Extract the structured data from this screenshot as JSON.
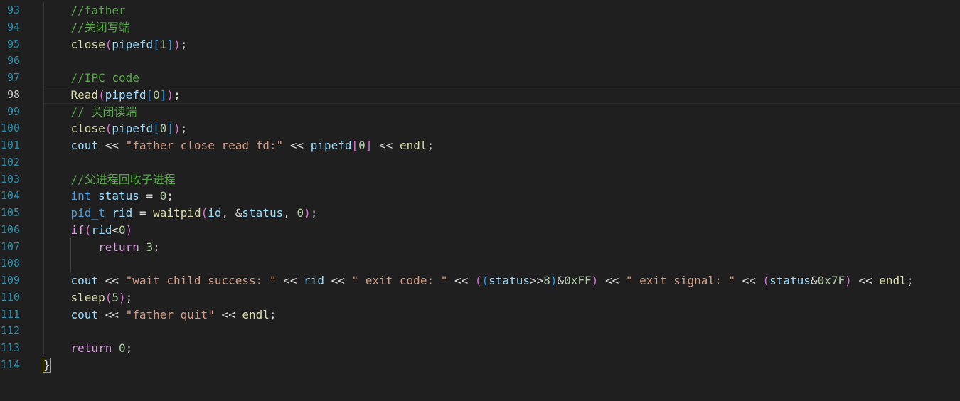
{
  "editor": {
    "lines": [
      {
        "no": "93",
        "tokens": [
          {
            "t": "    ",
            "c": "plain"
          },
          {
            "t": "//father",
            "c": "comment"
          }
        ]
      },
      {
        "no": "94",
        "tokens": [
          {
            "t": "    ",
            "c": "plain"
          },
          {
            "t": "//关闭写端",
            "c": "comment"
          }
        ]
      },
      {
        "no": "95",
        "tokens": [
          {
            "t": "    ",
            "c": "plain"
          },
          {
            "t": "close",
            "c": "func"
          },
          {
            "t": "(",
            "c": "bracket2"
          },
          {
            "t": "pipefd",
            "c": "var"
          },
          {
            "t": "[",
            "c": "bracket3"
          },
          {
            "t": "1",
            "c": "number"
          },
          {
            "t": "]",
            "c": "bracket3"
          },
          {
            "t": ")",
            "c": "bracket2"
          },
          {
            "t": ";",
            "c": "plain"
          }
        ]
      },
      {
        "no": "96",
        "tokens": []
      },
      {
        "no": "97",
        "tokens": [
          {
            "t": "    ",
            "c": "plain"
          },
          {
            "t": "//IPC code",
            "c": "comment"
          }
        ]
      },
      {
        "no": "98",
        "current": true,
        "tokens": [
          {
            "t": "    ",
            "c": "plain"
          },
          {
            "t": "Read",
            "c": "func"
          },
          {
            "t": "(",
            "c": "bracket2"
          },
          {
            "t": "pipefd",
            "c": "var"
          },
          {
            "t": "[",
            "c": "bracket3"
          },
          {
            "t": "0",
            "c": "number"
          },
          {
            "t": "]",
            "c": "bracket3"
          },
          {
            "t": ")",
            "c": "bracket2"
          },
          {
            "t": ";",
            "c": "plain"
          }
        ]
      },
      {
        "no": "99",
        "tokens": [
          {
            "t": "    ",
            "c": "plain"
          },
          {
            "t": "// 关闭读端",
            "c": "comment"
          }
        ]
      },
      {
        "no": "100",
        "tokens": [
          {
            "t": "    ",
            "c": "plain"
          },
          {
            "t": "close",
            "c": "func"
          },
          {
            "t": "(",
            "c": "bracket2"
          },
          {
            "t": "pipefd",
            "c": "var"
          },
          {
            "t": "[",
            "c": "bracket3"
          },
          {
            "t": "0",
            "c": "number"
          },
          {
            "t": "]",
            "c": "bracket3"
          },
          {
            "t": ")",
            "c": "bracket2"
          },
          {
            "t": ";",
            "c": "plain"
          }
        ]
      },
      {
        "no": "101",
        "tokens": [
          {
            "t": "    ",
            "c": "plain"
          },
          {
            "t": "cout",
            "c": "var"
          },
          {
            "t": " << ",
            "c": "plain"
          },
          {
            "t": "\"father close read fd:\"",
            "c": "string"
          },
          {
            "t": " << ",
            "c": "plain"
          },
          {
            "t": "pipefd",
            "c": "var"
          },
          {
            "t": "[",
            "c": "bracket2"
          },
          {
            "t": "0",
            "c": "number"
          },
          {
            "t": "]",
            "c": "bracket2"
          },
          {
            "t": " << ",
            "c": "plain"
          },
          {
            "t": "endl",
            "c": "func"
          },
          {
            "t": ";",
            "c": "plain"
          }
        ]
      },
      {
        "no": "102",
        "tokens": []
      },
      {
        "no": "103",
        "tokens": [
          {
            "t": "    ",
            "c": "plain"
          },
          {
            "t": "//父进程回收子进程",
            "c": "comment"
          }
        ]
      },
      {
        "no": "104",
        "tokens": [
          {
            "t": "    ",
            "c": "plain"
          },
          {
            "t": "int",
            "c": "keyword"
          },
          {
            "t": " ",
            "c": "plain"
          },
          {
            "t": "status",
            "c": "var"
          },
          {
            "t": " = ",
            "c": "plain"
          },
          {
            "t": "0",
            "c": "number"
          },
          {
            "t": ";",
            "c": "plain"
          }
        ]
      },
      {
        "no": "105",
        "tokens": [
          {
            "t": "    ",
            "c": "plain"
          },
          {
            "t": "pid_t",
            "c": "keyword"
          },
          {
            "t": " ",
            "c": "plain"
          },
          {
            "t": "rid",
            "c": "var"
          },
          {
            "t": " = ",
            "c": "plain"
          },
          {
            "t": "waitpid",
            "c": "func"
          },
          {
            "t": "(",
            "c": "bracket2"
          },
          {
            "t": "id",
            "c": "var"
          },
          {
            "t": ", &",
            "c": "plain"
          },
          {
            "t": "status",
            "c": "var"
          },
          {
            "t": ", ",
            "c": "plain"
          },
          {
            "t": "0",
            "c": "number"
          },
          {
            "t": ")",
            "c": "bracket2"
          },
          {
            "t": ";",
            "c": "plain"
          }
        ]
      },
      {
        "no": "106",
        "tokens": [
          {
            "t": "    ",
            "c": "plain"
          },
          {
            "t": "if",
            "c": "control"
          },
          {
            "t": "(",
            "c": "bracket2"
          },
          {
            "t": "rid",
            "c": "var"
          },
          {
            "t": "<",
            "c": "plain"
          },
          {
            "t": "0",
            "c": "number"
          },
          {
            "t": ")",
            "c": "bracket2"
          }
        ]
      },
      {
        "no": "107",
        "tokens": [
          {
            "t": "        ",
            "c": "plain"
          },
          {
            "t": "return",
            "c": "control"
          },
          {
            "t": " ",
            "c": "plain"
          },
          {
            "t": "3",
            "c": "number"
          },
          {
            "t": ";",
            "c": "plain"
          }
        ]
      },
      {
        "no": "108",
        "tokens": []
      },
      {
        "no": "109",
        "tokens": [
          {
            "t": "    ",
            "c": "plain"
          },
          {
            "t": "cout",
            "c": "var"
          },
          {
            "t": " << ",
            "c": "plain"
          },
          {
            "t": "\"wait child success: \"",
            "c": "string"
          },
          {
            "t": " << ",
            "c": "plain"
          },
          {
            "t": "rid",
            "c": "var"
          },
          {
            "t": " << ",
            "c": "plain"
          },
          {
            "t": "\" exit code: \"",
            "c": "string"
          },
          {
            "t": " << ",
            "c": "plain"
          },
          {
            "t": "(",
            "c": "bracket2"
          },
          {
            "t": "(",
            "c": "bracket3"
          },
          {
            "t": "status",
            "c": "var"
          },
          {
            "t": ">>",
            "c": "plain"
          },
          {
            "t": "8",
            "c": "number"
          },
          {
            "t": ")",
            "c": "bracket3"
          },
          {
            "t": "&",
            "c": "plain"
          },
          {
            "t": "0xFF",
            "c": "number"
          },
          {
            "t": ")",
            "c": "bracket2"
          },
          {
            "t": " << ",
            "c": "plain"
          },
          {
            "t": "\" exit signal: \"",
            "c": "string"
          },
          {
            "t": " << ",
            "c": "plain"
          },
          {
            "t": "(",
            "c": "bracket2"
          },
          {
            "t": "status",
            "c": "var"
          },
          {
            "t": "&",
            "c": "plain"
          },
          {
            "t": "0x7F",
            "c": "number"
          },
          {
            "t": ")",
            "c": "bracket2"
          },
          {
            "t": " << ",
            "c": "plain"
          },
          {
            "t": "endl",
            "c": "func"
          },
          {
            "t": ";",
            "c": "plain"
          }
        ]
      },
      {
        "no": "110",
        "tokens": [
          {
            "t": "    ",
            "c": "plain"
          },
          {
            "t": "sleep",
            "c": "func"
          },
          {
            "t": "(",
            "c": "bracket2"
          },
          {
            "t": "5",
            "c": "number"
          },
          {
            "t": ")",
            "c": "bracket2"
          },
          {
            "t": ";",
            "c": "plain"
          }
        ]
      },
      {
        "no": "111",
        "tokens": [
          {
            "t": "    ",
            "c": "plain"
          },
          {
            "t": "cout",
            "c": "var"
          },
          {
            "t": " << ",
            "c": "plain"
          },
          {
            "t": "\"father quit\"",
            "c": "string"
          },
          {
            "t": " << ",
            "c": "plain"
          },
          {
            "t": "endl",
            "c": "func"
          },
          {
            "t": ";",
            "c": "plain"
          }
        ]
      },
      {
        "no": "112",
        "tokens": []
      },
      {
        "no": "113",
        "tokens": [
          {
            "t": "    ",
            "c": "plain"
          },
          {
            "t": "return",
            "c": "control"
          },
          {
            "t": " ",
            "c": "plain"
          },
          {
            "t": "0",
            "c": "number"
          },
          {
            "t": ";",
            "c": "plain"
          }
        ]
      },
      {
        "no": "114",
        "tokens": [
          {
            "t": "}",
            "c": "brace"
          }
        ]
      }
    ]
  }
}
